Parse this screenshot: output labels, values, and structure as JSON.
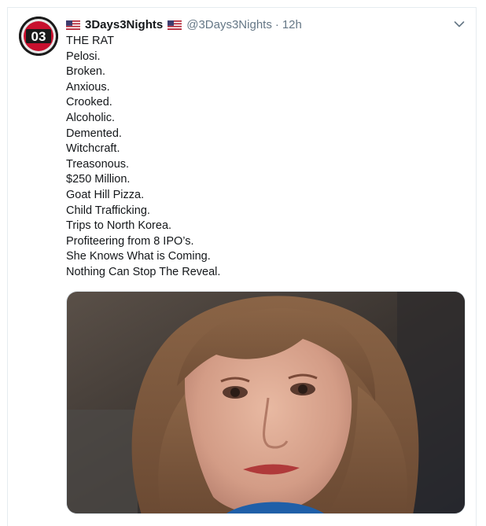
{
  "tweet": {
    "display_name": "3Days3Nights",
    "handle": "@3Days3Nights",
    "separator": "·",
    "timestamp": "12h",
    "avatar_text": "03",
    "flag_icon": "us-flag-icon",
    "menu_icon": "chevron-down-icon",
    "lines": [
      "THE RAT",
      "Pelosi.",
      "Broken.",
      "Anxious.",
      "Crooked.",
      "Alcoholic.",
      "Demented.",
      "Witchcraft.",
      "Treasonous.",
      "$250 Million.",
      "Goat Hill Pizza.",
      "Child Trafficking.",
      "Trips to North Korea.",
      "Profiteering from 8 IPO’s.",
      "She Knows What is Coming.",
      "Nothing Can Stop The Reveal."
    ]
  },
  "colors": {
    "text": "#14171a",
    "secondary": "#657786",
    "border": "#e6ecf0",
    "avatar_red": "#c8102e"
  }
}
